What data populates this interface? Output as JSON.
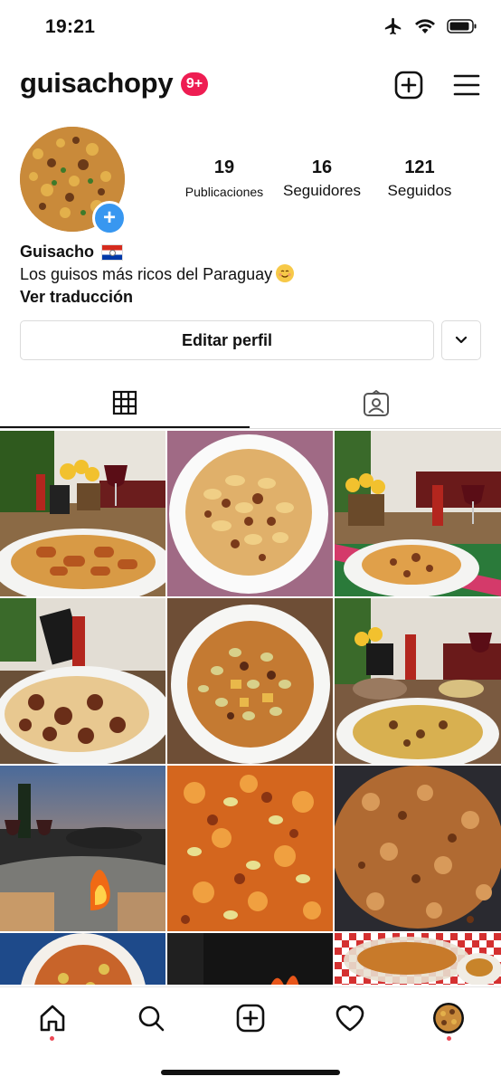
{
  "status_bar": {
    "time": "19:21",
    "icons": [
      "airplane-icon",
      "wifi-icon",
      "battery-icon"
    ]
  },
  "header": {
    "username": "guisachopy",
    "notification_badge": "9+",
    "actions": [
      "new-post-icon",
      "menu-icon"
    ]
  },
  "profile": {
    "stats": [
      {
        "value": "19",
        "label": "Publicaciones"
      },
      {
        "value": "16",
        "label": "Seguidores"
      },
      {
        "value": "121",
        "label": "Seguidos"
      }
    ],
    "name": "Guisacho",
    "bio": "Los guisos más ricos del Paraguay",
    "translate_link": "Ver traducción",
    "edit_button": "Editar perfil"
  },
  "tabs": [
    {
      "icon": "grid-icon",
      "active": true
    },
    {
      "icon": "tagged-icon",
      "active": false
    }
  ],
  "posts_count_visible": 12,
  "bottom_nav": [
    "home-icon",
    "search-icon",
    "new-post-icon",
    "activity-heart-icon",
    "profile-avatar"
  ],
  "colors": {
    "badge": "#ee1d52",
    "avatar_add": "#3897f0",
    "notification_dot": "#ed4956"
  }
}
